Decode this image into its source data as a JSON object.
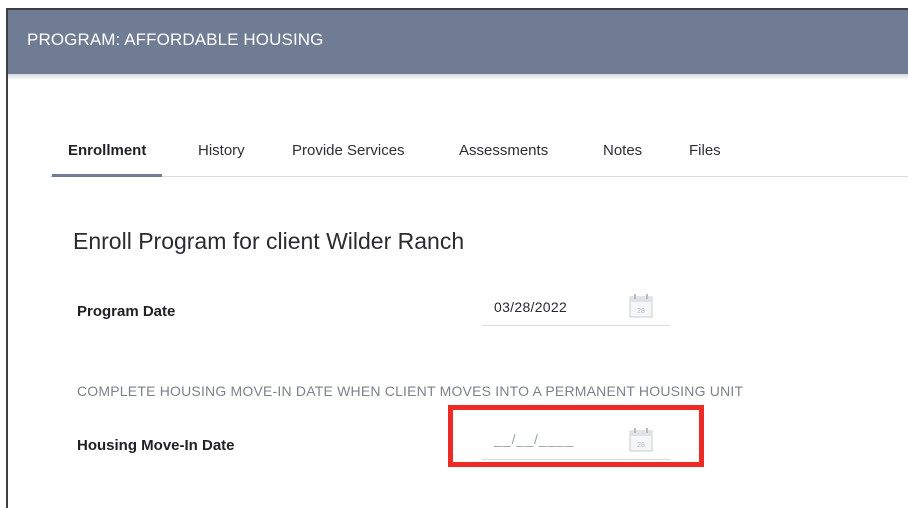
{
  "header": {
    "title": "PROGRAM: AFFORDABLE HOUSING"
  },
  "tabs": [
    {
      "label": "Enrollment",
      "active": true
    },
    {
      "label": "History",
      "active": false
    },
    {
      "label": "Provide Services",
      "active": false
    },
    {
      "label": "Assessments",
      "active": false
    },
    {
      "label": "Notes",
      "active": false
    },
    {
      "label": "Files",
      "active": false
    }
  ],
  "form": {
    "title": "Enroll Program for client Wilder Ranch",
    "program_date": {
      "label": "Program Date",
      "value": "03/28/2022",
      "calendar_icon_text": "28"
    },
    "notice": "COMPLETE HOUSING MOVE-IN DATE WHEN CLIENT MOVES INTO A PERMANENT HOUSING UNIT",
    "move_in_date": {
      "label": "Housing Move-In Date",
      "placeholder": "__/__/____",
      "value": "",
      "calendar_icon_text": "28"
    }
  },
  "colors": {
    "header_bg": "#6f7c93",
    "highlight": "#ee2a24",
    "active_tab_underline": "#6f7c93"
  },
  "icons": {
    "calendar": "calendar-icon"
  }
}
